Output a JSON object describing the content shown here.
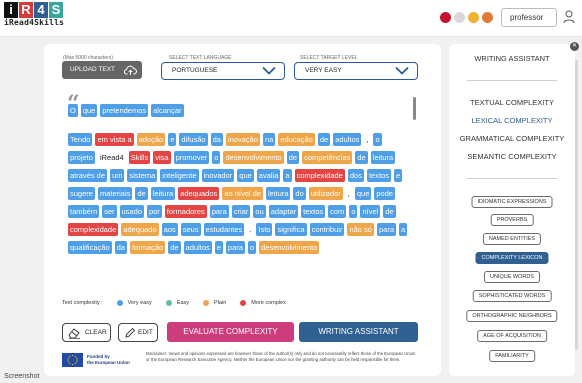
{
  "header": {
    "logo_letters": [
      "i",
      "R",
      "4",
      "S"
    ],
    "logo_colors": [
      "#111111",
      "#d83a3a",
      "#2f6091",
      "#3aa6a0"
    ],
    "logo_word": "iRead4Skills",
    "user_name": "professor",
    "flag_colors": [
      "#c8102e",
      "#d9d9d9",
      "#f2b233",
      "#e07a3a"
    ]
  },
  "controls": {
    "max_chars_label": "(Max 5000 characters)",
    "upload_label": "UPLOAD TEXT",
    "language_label": "SELECT TEXT LANGUAGE",
    "language_value": "PORTUGUESE",
    "level_label": "SELECT TARGET LEVEL",
    "level_value": "VERY EASY"
  },
  "text_paragraphs": [
    [
      {
        "t": "O",
        "c": "b"
      },
      {
        "t": "que",
        "c": "b"
      },
      {
        "t": "pretendemos",
        "c": "b"
      },
      {
        "t": "alcançar",
        "c": "b"
      }
    ],
    [
      {
        "t": "Tendo",
        "c": "b"
      },
      {
        "t": "em vista a",
        "c": "r"
      },
      {
        "t": "adoção",
        "c": "o"
      },
      {
        "t": "e",
        "c": "b"
      },
      {
        "t": "difusão",
        "c": "b"
      },
      {
        "t": "da",
        "c": "b"
      },
      {
        "t": "inovação",
        "c": "o"
      },
      {
        "t": "na",
        "c": "b"
      },
      {
        "t": "educação",
        "c": "o"
      },
      {
        "t": "de",
        "c": "b"
      },
      {
        "t": "adultos",
        "c": "b"
      },
      {
        "t": ",",
        "c": "n"
      },
      {
        "t": "o",
        "c": "b"
      },
      {
        "t": "projeto",
        "c": "b"
      },
      {
        "t": "iRead4",
        "c": "n"
      },
      {
        "t": "Skills",
        "c": "r"
      },
      {
        "t": "visa",
        "c": "r"
      },
      {
        "t": "promover",
        "c": "b"
      },
      {
        "t": "o",
        "c": "b"
      },
      {
        "t": "desenvolvimento",
        "c": "o"
      },
      {
        "t": "de",
        "c": "b"
      },
      {
        "t": "competências",
        "c": "o"
      },
      {
        "t": "de",
        "c": "b"
      },
      {
        "t": "leitura",
        "c": "b"
      },
      {
        "t": "através de",
        "c": "b"
      },
      {
        "t": "um",
        "c": "b"
      },
      {
        "t": "sistema",
        "c": "b"
      },
      {
        "t": "inteligente",
        "c": "b"
      },
      {
        "t": "inovador",
        "c": "b"
      },
      {
        "t": "que",
        "c": "b"
      },
      {
        "t": "avalia",
        "c": "b"
      },
      {
        "t": "a",
        "c": "b"
      },
      {
        "t": "complexidade",
        "c": "r"
      },
      {
        "t": "dos",
        "c": "b"
      },
      {
        "t": "textos",
        "c": "b"
      },
      {
        "t": "e",
        "c": "b"
      },
      {
        "t": "sugere",
        "c": "b"
      },
      {
        "t": "materiais",
        "c": "b"
      },
      {
        "t": "de",
        "c": "b"
      },
      {
        "t": "leitura",
        "c": "b"
      },
      {
        "t": "adequados",
        "c": "r"
      },
      {
        "t": "ao nível de",
        "c": "o"
      },
      {
        "t": "leitura",
        "c": "b"
      },
      {
        "t": "do",
        "c": "b"
      },
      {
        "t": "utilizador",
        "c": "o"
      },
      {
        "t": ",",
        "c": "n"
      },
      {
        "t": "que",
        "c": "b"
      },
      {
        "t": "pode",
        "c": "b"
      },
      {
        "t": "também",
        "c": "b"
      },
      {
        "t": "ser",
        "c": "b"
      },
      {
        "t": "usado",
        "c": "b"
      },
      {
        "t": "por",
        "c": "b"
      },
      {
        "t": "formadores",
        "c": "r"
      },
      {
        "t": "para",
        "c": "b"
      },
      {
        "t": "criar",
        "c": "b"
      },
      {
        "t": "ou",
        "c": "b"
      },
      {
        "t": "adaptar",
        "c": "b"
      },
      {
        "t": "textos",
        "c": "b"
      },
      {
        "t": "com",
        "c": "b"
      },
      {
        "t": "o",
        "c": "b"
      },
      {
        "t": "nível",
        "c": "b"
      },
      {
        "t": "de",
        "c": "b"
      },
      {
        "t": "complexidade",
        "c": "r"
      },
      {
        "t": "adequado",
        "c": "o"
      },
      {
        "t": "aos",
        "c": "b"
      },
      {
        "t": "seus",
        "c": "b"
      },
      {
        "t": "estudantes",
        "c": "b"
      },
      {
        "t": ".",
        "c": "n"
      },
      {
        "t": "Isto",
        "c": "b"
      },
      {
        "t": "significa",
        "c": "b"
      },
      {
        "t": "contribuir",
        "c": "b"
      },
      {
        "t": "não só",
        "c": "o"
      },
      {
        "t": "para",
        "c": "b"
      },
      {
        "t": "a",
        "c": "b"
      },
      {
        "t": "qualificação",
        "c": "b"
      },
      {
        "t": "da",
        "c": "b"
      },
      {
        "t": "formação",
        "c": "o"
      },
      {
        "t": "de",
        "c": "b"
      },
      {
        "t": "adultos",
        "c": "b"
      },
      {
        "t": "e",
        "c": "b"
      },
      {
        "t": "para",
        "c": "b"
      },
      {
        "t": "o",
        "c": "b"
      },
      {
        "t": "desenvolvimento",
        "c": "o"
      }
    ]
  ],
  "legend": {
    "title": "Text complexity :",
    "items": [
      {
        "label": "Very easy",
        "color": "#4e9ee8"
      },
      {
        "label": "Easy",
        "color": "#5fc09c"
      },
      {
        "label": "Plain",
        "color": "#efa64a"
      },
      {
        "label": "More complex",
        "color": "#e34545"
      }
    ]
  },
  "actions": {
    "clear": "CLEAR",
    "edit": "EDIT",
    "evaluate": "EVALUATE COMPLEXITY",
    "writing_assistant": "WRITING ASSISTANT"
  },
  "footer": {
    "funded_line1": "Funded by",
    "funded_line2": "the European Union",
    "disclaimer": "Disclaimer: Views and opinions expressed are however those of the author(s) only and do not necessarily reflect those of the European Union or the European Research Executive Agency. Neither the European Union nor the granting authority can be held responsible for them."
  },
  "caption": "Screenshot",
  "sidebar": {
    "title": "WRITING ASSISTANT",
    "close": "×",
    "categories": [
      {
        "label": "TEXTUAL COMPLEXITY",
        "active": false
      },
      {
        "label": "LEXICAL COMPLEXITY",
        "active": true
      },
      {
        "label": "GRAMMATICAL COMPLEXITY",
        "active": false
      },
      {
        "label": "SEMANTIC COMPLEXITY",
        "active": false
      }
    ],
    "features": [
      {
        "label": "IDIOMATIC EXPRESSIONS",
        "selected": false
      },
      {
        "label": "PROVERBS",
        "selected": false
      },
      {
        "label": "NAMED ENTITIES",
        "selected": false
      },
      {
        "label": "COMPLEXITY LEXICON",
        "selected": true
      },
      {
        "label": "UNIQUE WORDS",
        "selected": false
      },
      {
        "label": "SOPHISTICATED WORDS",
        "selected": false
      },
      {
        "label": "ORTHOGRAPHIC NEIGHBORS",
        "selected": false
      },
      {
        "label": "AGE OF ACQUISITION",
        "selected": false
      },
      {
        "label": "FAMILIARITY",
        "selected": false
      }
    ]
  }
}
